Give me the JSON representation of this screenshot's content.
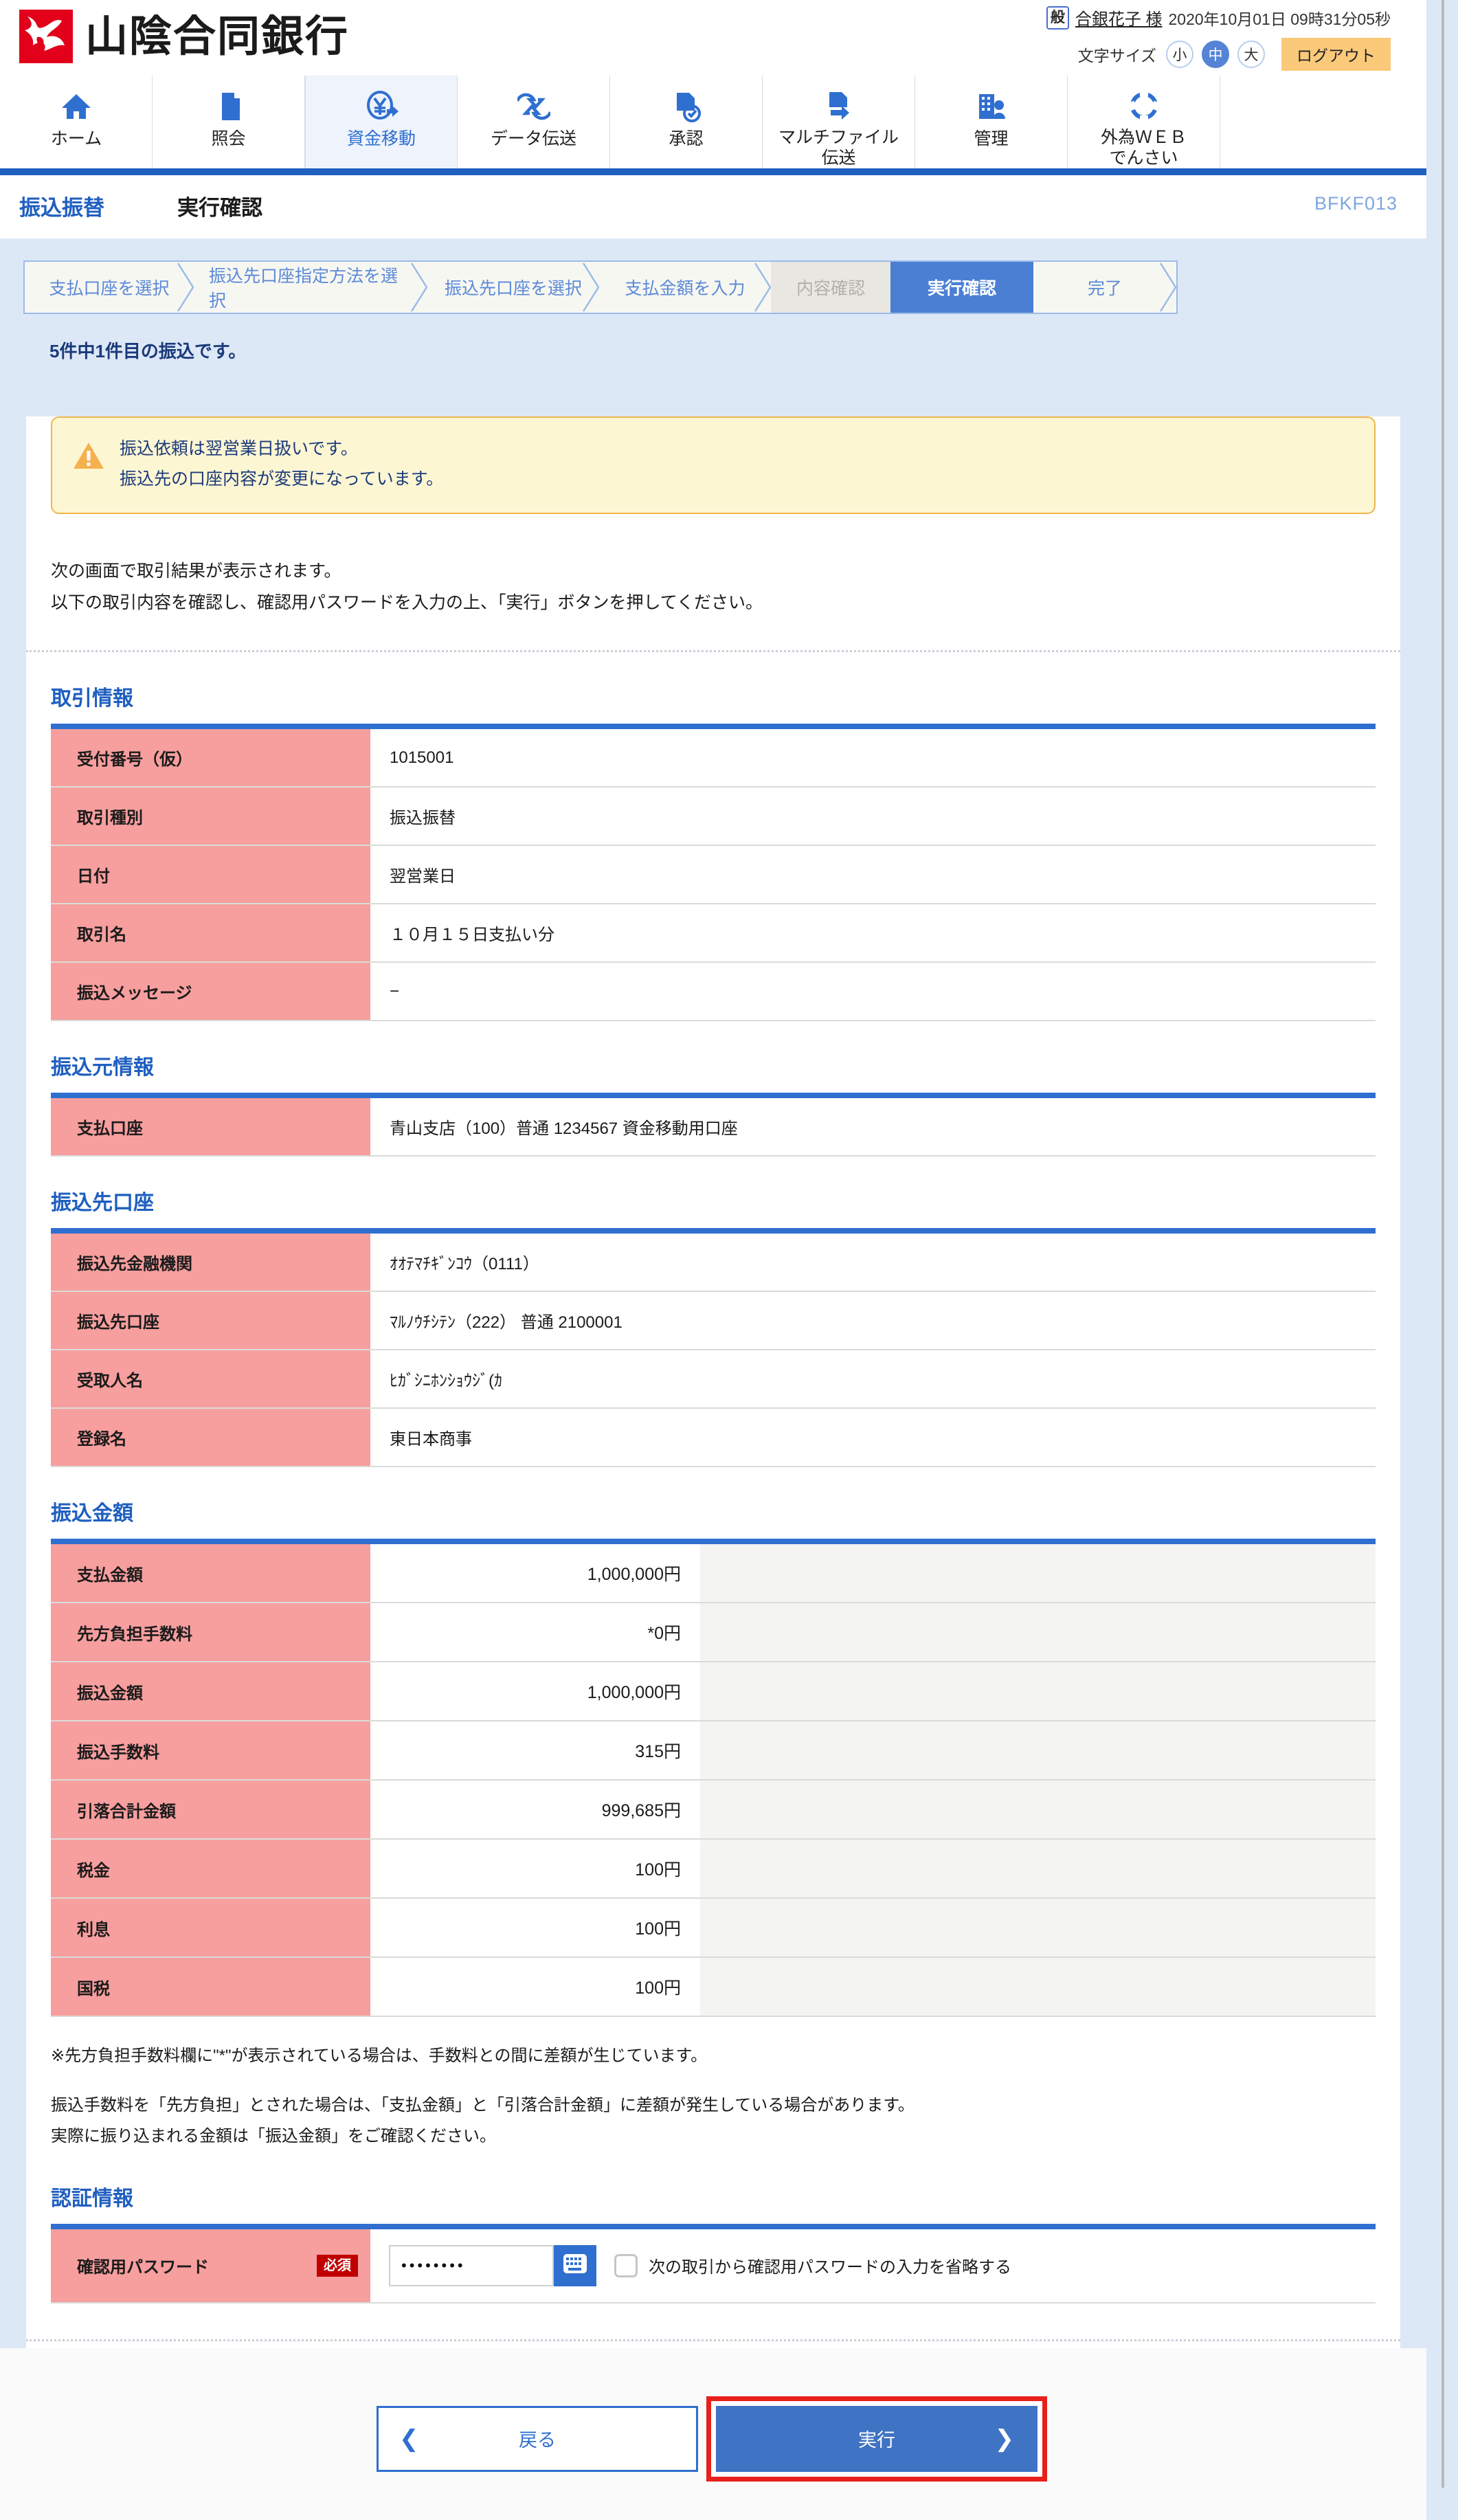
{
  "header": {
    "bank_name": "山陰合同銀行",
    "user_badge": "般",
    "user_name": "合銀花子 様",
    "datetime": "2020年10月01日 09時31分05秒",
    "fontsize_label": "文字サイズ",
    "fontsize_small": "小",
    "fontsize_medium": "中",
    "fontsize_large": "大",
    "logout_label": "ログアウト",
    "accent_blue": "#2f6fd0",
    "logout_bg": "#fbc97a"
  },
  "gnav": [
    {
      "label": "ホーム",
      "icon": "home-icon",
      "active": false
    },
    {
      "label": "照会",
      "icon": "document-icon",
      "active": false
    },
    {
      "label": "資金移動",
      "icon": "yen-transfer-icon",
      "active": true
    },
    {
      "label": "データ伝送",
      "icon": "sync-arrows-icon",
      "active": false
    },
    {
      "label": "承認",
      "icon": "document-check-icon",
      "active": false
    },
    {
      "label": "マルチファイル\n伝送",
      "label_line1": "マルチファイル",
      "label_line2": "伝送",
      "icon": "document-arrow-icon",
      "active": false
    },
    {
      "label": "管理",
      "icon": "building-user-icon",
      "active": false
    },
    {
      "label": "外為ＷＥＢ\nでんさい",
      "label_line1": "外為ＷＥＢ",
      "label_line2": "でんさい",
      "icon": "globe-icon",
      "active": false
    }
  ],
  "title": {
    "category": "振込振替",
    "page": "実行確認",
    "screen_id": "BFKF013"
  },
  "steps": [
    {
      "label": "支払口座を選択",
      "state": "done"
    },
    {
      "label": "振込先口座指定方法を選択",
      "state": "done"
    },
    {
      "label": "振込先口座を選択",
      "state": "done"
    },
    {
      "label": "支払金額を入力",
      "state": "done"
    },
    {
      "label": "内容確認",
      "state": "disabled"
    },
    {
      "label": "実行確認",
      "state": "current"
    },
    {
      "label": "完了",
      "state": "done"
    }
  ],
  "count_text": "5件中1件目の振込です。",
  "warning": {
    "icon": "warning-triangle-icon",
    "line1": "振込依頼は翌営業日扱いです。",
    "line2": "振込先の口座内容が変更になっています。"
  },
  "lead": {
    "line1": "次の画面で取引結果が表示されます。",
    "line2": "以下の取引内容を確認し、確認用パスワードを入力の上、「実行」ボタンを押してください。"
  },
  "sections": {
    "transaction": {
      "heading": "取引情報",
      "rows": [
        {
          "key": "受付番号（仮）",
          "value": "1015001"
        },
        {
          "key": "取引種別",
          "value": "振込振替"
        },
        {
          "key": "日付",
          "value": "翌営業日"
        },
        {
          "key": "取引名",
          "value": "１０月１５日支払い分"
        },
        {
          "key": "振込メッセージ",
          "value": "−"
        }
      ]
    },
    "source": {
      "heading": "振込元情報",
      "rows": [
        {
          "key": "支払口座",
          "value": "青山支店（100）普通 1234567 資金移動用口座"
        }
      ]
    },
    "destination": {
      "heading": "振込先口座",
      "rows": [
        {
          "key": "振込先金融機関",
          "value": "ｵｵﾃﾏﾁｷﾞﾝｺｳ（0111）"
        },
        {
          "key": "振込先口座",
          "value": "ﾏﾙﾉｳﾁｼﾃﾝ（222） 普通 2100001"
        },
        {
          "key": "受取人名",
          "value": "ﾋｶﾞｼﾆﾎﾝｼｮｳｼﾞ(ｶ"
        },
        {
          "key": "登録名",
          "value": "東日本商事"
        }
      ]
    },
    "amount": {
      "heading": "振込金額",
      "rows": [
        {
          "key": "支払金額",
          "value": "1,000,000円"
        },
        {
          "key": "先方負担手数料",
          "value": "*0円"
        },
        {
          "key": "振込金額",
          "value": "1,000,000円"
        },
        {
          "key": "振込手数料",
          "value": "315円"
        },
        {
          "key": "引落合計金額",
          "value": "999,685円"
        },
        {
          "key": "税金",
          "value": "100円"
        },
        {
          "key": "利息",
          "value": "100円"
        },
        {
          "key": "国税",
          "value": "100円"
        }
      ]
    },
    "auth": {
      "heading": "認証情報",
      "label": "確認用パスワード",
      "required_badge": "必須",
      "password_value": "••••••••",
      "password_placeholder": "",
      "keyboard_icon": "software-keyboard-icon",
      "checkbox_label": "次の取引から確認用パスワードの入力を省略する",
      "checkbox_checked": false
    }
  },
  "notes": {
    "line1": "※先方負担手数料欄に\"*\"が表示されている場合は、手数料との間に差額が生じています。",
    "line2": "振込手数料を「先方負担」とされた場合は、「支払金額」と「引落合計金額」に差額が発生している場合があります。",
    "line3": "実際に振り込まれる金額は「振込金額」をご確認ください。"
  },
  "footer": {
    "back_label": "戻る",
    "back_arrow": "❮",
    "exec_label": "実行",
    "exec_arrow": "❯",
    "highlight_color": "#e8201b"
  }
}
